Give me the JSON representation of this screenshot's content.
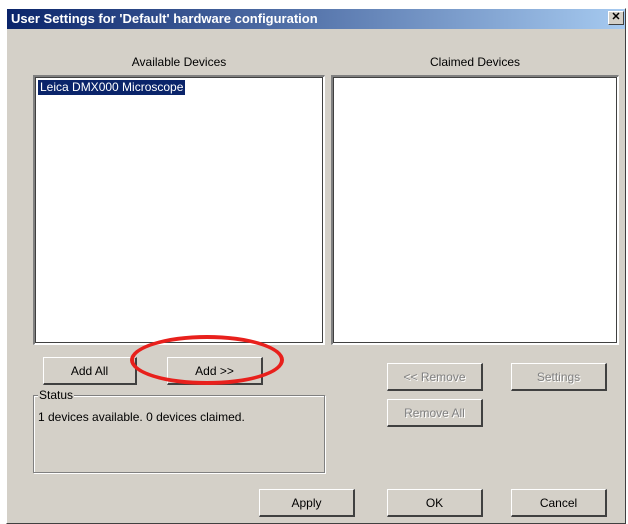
{
  "window": {
    "title": "User Settings for 'Default' hardware configuration",
    "close_glyph": "✕"
  },
  "available": {
    "heading": "Available Devices",
    "items": [
      {
        "label": "Leica DMX000 Microscope",
        "selected": true
      }
    ]
  },
  "claimed": {
    "heading": "Claimed Devices",
    "items": []
  },
  "buttons": {
    "add_all": "Add All",
    "add": "Add >>",
    "remove": "<< Remove",
    "settings": "Settings",
    "remove_all": "Remove All",
    "apply": "Apply",
    "ok": "OK",
    "cancel": "Cancel"
  },
  "status": {
    "legend": "Status",
    "text": "1 devices available. 0 devices claimed."
  },
  "colors": {
    "title_gradient_start": "#0a246a",
    "title_gradient_end": "#a6caf0",
    "dialog_face": "#d4d0c8",
    "selection": "#0a246a",
    "annotation": "#e8201c"
  }
}
